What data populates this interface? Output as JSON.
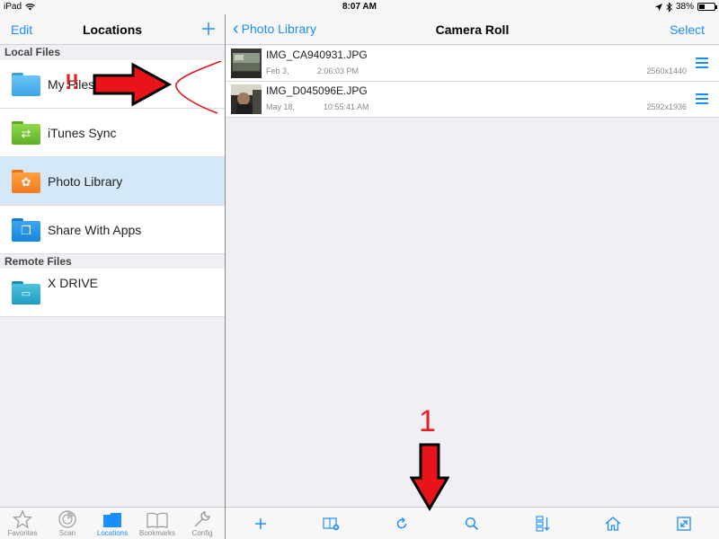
{
  "status_bar": {
    "device": "iPad",
    "time": "8:07 AM",
    "battery": "38%",
    "battery_level": 0.38
  },
  "left_pane": {
    "edit_label": "Edit",
    "title": "Locations",
    "add_icon": "plus-icon",
    "sections": [
      {
        "header": "Local Files",
        "items": [
          {
            "label": "My Files",
            "icon": "folder-icon",
            "color": "#4db1ec"
          },
          {
            "label": "iTunes Sync",
            "icon": "sync-folder-icon",
            "color": "#6bbf2b"
          },
          {
            "label": "Photo Library",
            "icon": "photo-folder-icon",
            "color": "#f7842a"
          },
          {
            "label": "Share With Apps",
            "icon": "share-folder-icon",
            "color": "#1d8fe0"
          }
        ]
      },
      {
        "header": "Remote Files",
        "items": [
          {
            "label": "X DRIVE",
            "icon": "drive-folder-icon",
            "color": "#26a6c9"
          }
        ]
      }
    ],
    "tabs": [
      {
        "label": "Favorites",
        "icon": "star-icon"
      },
      {
        "label": "Scan",
        "icon": "radar-icon"
      },
      {
        "label": "Locations",
        "icon": "folder-icon",
        "active": true
      },
      {
        "label": "Bookmarks",
        "icon": "book-icon"
      },
      {
        "label": "Config",
        "icon": "wrench-icon"
      }
    ]
  },
  "right_pane": {
    "back_label": "Photo Library",
    "title": "Camera Roll",
    "select_label": "Select",
    "files": [
      {
        "name": "IMG_CA940931.JPG",
        "date": "Feb 3,",
        "time": "2:06:03 PM",
        "dimensions": "2560x1440"
      },
      {
        "name": "IMG_D045096E.JPG",
        "date": "May 18,",
        "time": "10:55:41 AM",
        "dimensions": "2592x1936"
      }
    ],
    "toolbar": [
      "plus-icon",
      "new-folder-icon",
      "refresh-icon",
      "search-icon",
      "sort-icon",
      "home-icon",
      "expand-icon"
    ]
  },
  "annotations": {
    "exclamation": "!!",
    "step_number": "1",
    "color": "#e02020"
  },
  "colors": {
    "accent": "#1a8dff",
    "selected_row": "#d4e8f7"
  }
}
